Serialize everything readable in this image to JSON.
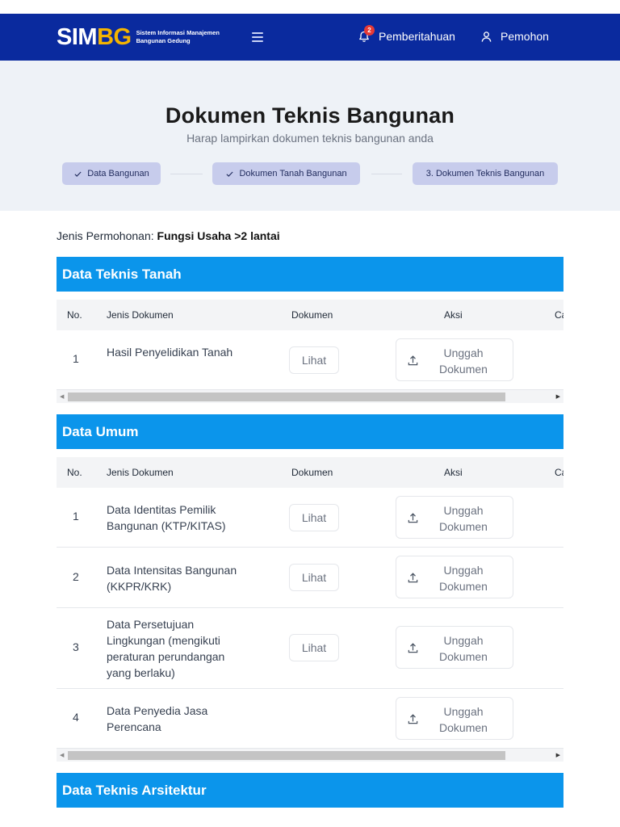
{
  "header": {
    "logo_main": "SIM",
    "logo_accent": "BG",
    "logo_subtitle": "Sistem Informasi Manajemen Bangunan Gedung",
    "notification_label": "Pemberitahuan",
    "notification_count": "2",
    "user_label": "Pemohon"
  },
  "hero": {
    "title": "Dokumen Teknis Bangunan",
    "subtitle": "Harap lampirkan dokumen teknis bangunan anda",
    "steps": [
      {
        "label": "Data Bangunan",
        "done": true
      },
      {
        "label": "Dokumen Tanah Bangunan",
        "done": true
      },
      {
        "label": "3. Dokumen Teknis Bangunan",
        "done": false
      }
    ]
  },
  "jenis": {
    "label": "Jenis Permohonan:",
    "value": "Fungsi Usaha >2 lantai"
  },
  "columns": {
    "no": "No.",
    "jenis": "Jenis Dokumen",
    "dokumen": "Dokumen",
    "aksi": "Aksi",
    "extra": "Ca"
  },
  "buttons": {
    "lihat": "Lihat",
    "unggah_line1": "Unggah",
    "unggah_line2": "Dokumen"
  },
  "sections": [
    {
      "title": "Data Teknis Tanah",
      "rows": [
        {
          "no": "1",
          "name": "Hasil Penyelidikan Tanah",
          "has_lihat": true
        }
      ]
    },
    {
      "title": "Data Umum",
      "rows": [
        {
          "no": "1",
          "name": "Data Identitas Pemilik Bangunan (KTP/KITAS)",
          "has_lihat": true
        },
        {
          "no": "2",
          "name": "Data Intensitas Bangunan (KKPR/KRK)",
          "has_lihat": true
        },
        {
          "no": "3",
          "name": "Data Persetujuan Lingkungan (mengikuti peraturan perundangan yang berlaku)",
          "has_lihat": true
        },
        {
          "no": "4",
          "name": "Data Penyedia Jasa Perencana",
          "has_lihat": false
        }
      ]
    },
    {
      "title": "Data Teknis Arsitektur",
      "rows": []
    }
  ]
}
